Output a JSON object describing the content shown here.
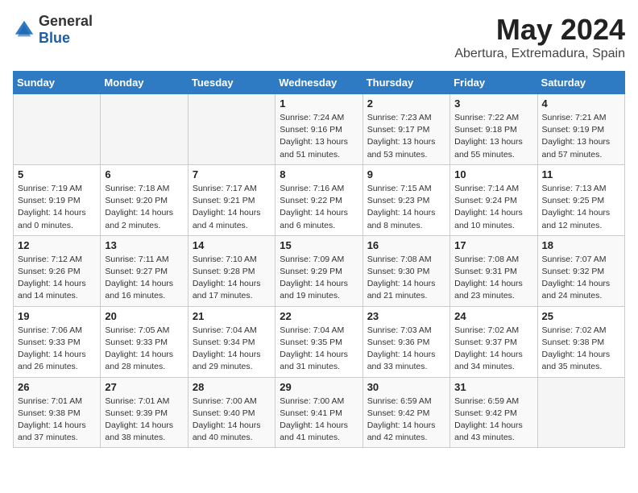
{
  "logo": {
    "general": "General",
    "blue": "Blue"
  },
  "header": {
    "month": "May 2024",
    "location": "Abertura, Extremadura, Spain"
  },
  "weekdays": [
    "Sunday",
    "Monday",
    "Tuesday",
    "Wednesday",
    "Thursday",
    "Friday",
    "Saturday"
  ],
  "weeks": [
    [
      {
        "day": "",
        "sunrise": "",
        "sunset": "",
        "daylight": ""
      },
      {
        "day": "",
        "sunrise": "",
        "sunset": "",
        "daylight": ""
      },
      {
        "day": "",
        "sunrise": "",
        "sunset": "",
        "daylight": ""
      },
      {
        "day": "1",
        "sunrise": "Sunrise: 7:24 AM",
        "sunset": "Sunset: 9:16 PM",
        "daylight": "Daylight: 13 hours and 51 minutes."
      },
      {
        "day": "2",
        "sunrise": "Sunrise: 7:23 AM",
        "sunset": "Sunset: 9:17 PM",
        "daylight": "Daylight: 13 hours and 53 minutes."
      },
      {
        "day": "3",
        "sunrise": "Sunrise: 7:22 AM",
        "sunset": "Sunset: 9:18 PM",
        "daylight": "Daylight: 13 hours and 55 minutes."
      },
      {
        "day": "4",
        "sunrise": "Sunrise: 7:21 AM",
        "sunset": "Sunset: 9:19 PM",
        "daylight": "Daylight: 13 hours and 57 minutes."
      }
    ],
    [
      {
        "day": "5",
        "sunrise": "Sunrise: 7:19 AM",
        "sunset": "Sunset: 9:19 PM",
        "daylight": "Daylight: 14 hours and 0 minutes."
      },
      {
        "day": "6",
        "sunrise": "Sunrise: 7:18 AM",
        "sunset": "Sunset: 9:20 PM",
        "daylight": "Daylight: 14 hours and 2 minutes."
      },
      {
        "day": "7",
        "sunrise": "Sunrise: 7:17 AM",
        "sunset": "Sunset: 9:21 PM",
        "daylight": "Daylight: 14 hours and 4 minutes."
      },
      {
        "day": "8",
        "sunrise": "Sunrise: 7:16 AM",
        "sunset": "Sunset: 9:22 PM",
        "daylight": "Daylight: 14 hours and 6 minutes."
      },
      {
        "day": "9",
        "sunrise": "Sunrise: 7:15 AM",
        "sunset": "Sunset: 9:23 PM",
        "daylight": "Daylight: 14 hours and 8 minutes."
      },
      {
        "day": "10",
        "sunrise": "Sunrise: 7:14 AM",
        "sunset": "Sunset: 9:24 PM",
        "daylight": "Daylight: 14 hours and 10 minutes."
      },
      {
        "day": "11",
        "sunrise": "Sunrise: 7:13 AM",
        "sunset": "Sunset: 9:25 PM",
        "daylight": "Daylight: 14 hours and 12 minutes."
      }
    ],
    [
      {
        "day": "12",
        "sunrise": "Sunrise: 7:12 AM",
        "sunset": "Sunset: 9:26 PM",
        "daylight": "Daylight: 14 hours and 14 minutes."
      },
      {
        "day": "13",
        "sunrise": "Sunrise: 7:11 AM",
        "sunset": "Sunset: 9:27 PM",
        "daylight": "Daylight: 14 hours and 16 minutes."
      },
      {
        "day": "14",
        "sunrise": "Sunrise: 7:10 AM",
        "sunset": "Sunset: 9:28 PM",
        "daylight": "Daylight: 14 hours and 17 minutes."
      },
      {
        "day": "15",
        "sunrise": "Sunrise: 7:09 AM",
        "sunset": "Sunset: 9:29 PM",
        "daylight": "Daylight: 14 hours and 19 minutes."
      },
      {
        "day": "16",
        "sunrise": "Sunrise: 7:08 AM",
        "sunset": "Sunset: 9:30 PM",
        "daylight": "Daylight: 14 hours and 21 minutes."
      },
      {
        "day": "17",
        "sunrise": "Sunrise: 7:08 AM",
        "sunset": "Sunset: 9:31 PM",
        "daylight": "Daylight: 14 hours and 23 minutes."
      },
      {
        "day": "18",
        "sunrise": "Sunrise: 7:07 AM",
        "sunset": "Sunset: 9:32 PM",
        "daylight": "Daylight: 14 hours and 24 minutes."
      }
    ],
    [
      {
        "day": "19",
        "sunrise": "Sunrise: 7:06 AM",
        "sunset": "Sunset: 9:33 PM",
        "daylight": "Daylight: 14 hours and 26 minutes."
      },
      {
        "day": "20",
        "sunrise": "Sunrise: 7:05 AM",
        "sunset": "Sunset: 9:33 PM",
        "daylight": "Daylight: 14 hours and 28 minutes."
      },
      {
        "day": "21",
        "sunrise": "Sunrise: 7:04 AM",
        "sunset": "Sunset: 9:34 PM",
        "daylight": "Daylight: 14 hours and 29 minutes."
      },
      {
        "day": "22",
        "sunrise": "Sunrise: 7:04 AM",
        "sunset": "Sunset: 9:35 PM",
        "daylight": "Daylight: 14 hours and 31 minutes."
      },
      {
        "day": "23",
        "sunrise": "Sunrise: 7:03 AM",
        "sunset": "Sunset: 9:36 PM",
        "daylight": "Daylight: 14 hours and 33 minutes."
      },
      {
        "day": "24",
        "sunrise": "Sunrise: 7:02 AM",
        "sunset": "Sunset: 9:37 PM",
        "daylight": "Daylight: 14 hours and 34 minutes."
      },
      {
        "day": "25",
        "sunrise": "Sunrise: 7:02 AM",
        "sunset": "Sunset: 9:38 PM",
        "daylight": "Daylight: 14 hours and 35 minutes."
      }
    ],
    [
      {
        "day": "26",
        "sunrise": "Sunrise: 7:01 AM",
        "sunset": "Sunset: 9:38 PM",
        "daylight": "Daylight: 14 hours and 37 minutes."
      },
      {
        "day": "27",
        "sunrise": "Sunrise: 7:01 AM",
        "sunset": "Sunset: 9:39 PM",
        "daylight": "Daylight: 14 hours and 38 minutes."
      },
      {
        "day": "28",
        "sunrise": "Sunrise: 7:00 AM",
        "sunset": "Sunset: 9:40 PM",
        "daylight": "Daylight: 14 hours and 40 minutes."
      },
      {
        "day": "29",
        "sunrise": "Sunrise: 7:00 AM",
        "sunset": "Sunset: 9:41 PM",
        "daylight": "Daylight: 14 hours and 41 minutes."
      },
      {
        "day": "30",
        "sunrise": "Sunrise: 6:59 AM",
        "sunset": "Sunset: 9:42 PM",
        "daylight": "Daylight: 14 hours and 42 minutes."
      },
      {
        "day": "31",
        "sunrise": "Sunrise: 6:59 AM",
        "sunset": "Sunset: 9:42 PM",
        "daylight": "Daylight: 14 hours and 43 minutes."
      },
      {
        "day": "",
        "sunrise": "",
        "sunset": "",
        "daylight": ""
      }
    ]
  ]
}
